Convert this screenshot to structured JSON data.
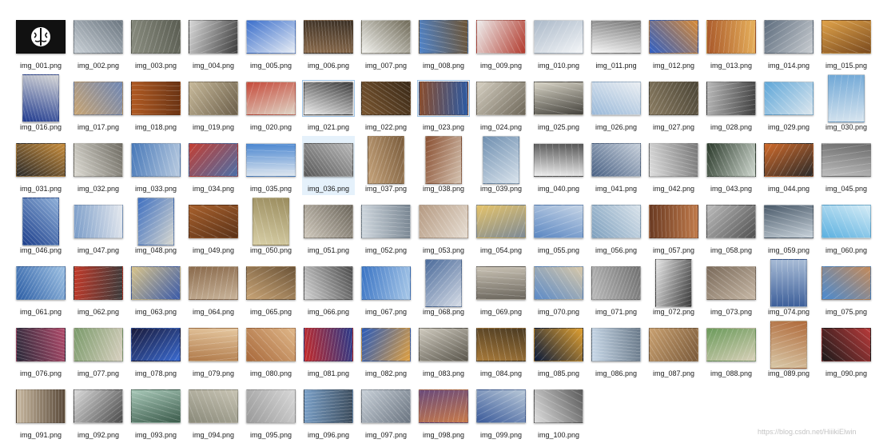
{
  "files": [
    {
      "name": "img_001.png",
      "colors": [
        "#111111",
        "#444444"
      ],
      "icon": "brain-icon"
    },
    {
      "name": "img_002.png",
      "colors": [
        "#c9d0d6",
        "#6b7680"
      ]
    },
    {
      "name": "img_003.png",
      "colors": [
        "#8a8d80",
        "#5a5d52"
      ]
    },
    {
      "name": "img_004.png",
      "colors": [
        "#d8d8d8",
        "#3c3c3c"
      ]
    },
    {
      "name": "img_005.png",
      "colors": [
        "#3a6ecb",
        "#e9eef5"
      ]
    },
    {
      "name": "img_006.png",
      "colors": [
        "#8b6b4c",
        "#3b3025"
      ]
    },
    {
      "name": "img_007.png",
      "colors": [
        "#f2f2ee",
        "#6f6a58"
      ]
    },
    {
      "name": "img_008.png",
      "colors": [
        "#4f83c9",
        "#6d5434"
      ]
    },
    {
      "name": "img_009.png",
      "colors": [
        "#eeeeee",
        "#b23b2e"
      ]
    },
    {
      "name": "img_010.png",
      "colors": [
        "#aab8c8",
        "#f4f6f8"
      ]
    },
    {
      "name": "img_011.png",
      "colors": [
        "#f6f6f6",
        "#777777"
      ]
    },
    {
      "name": "img_012.png",
      "colors": [
        "#2f5fc4",
        "#d88a36"
      ]
    },
    {
      "name": "img_013.png",
      "colors": [
        "#a9582a",
        "#e7b15c"
      ]
    },
    {
      "name": "img_014.png",
      "colors": [
        "#5d6c7d",
        "#c9cdd1"
      ]
    },
    {
      "name": "img_015.png",
      "colors": [
        "#e0a34a",
        "#7a4a1e"
      ]
    },
    {
      "name": "img_016.png",
      "colors": [
        "#1f3a8f",
        "#d6d6d6"
      ]
    },
    {
      "name": "img_017.png",
      "colors": [
        "#c8a472",
        "#6f87b5"
      ]
    },
    {
      "name": "img_018.png",
      "colors": [
        "#b05a22",
        "#6b3414"
      ]
    },
    {
      "name": "img_019.png",
      "colors": [
        "#c7b99a",
        "#6c5f4a"
      ]
    },
    {
      "name": "img_020.png",
      "colors": [
        "#c64a3a",
        "#dfd5c7"
      ]
    },
    {
      "name": "img_021.png",
      "colors": [
        "#ededed",
        "#3a3a3a"
      ]
    },
    {
      "name": "img_022.png",
      "colors": [
        "#7a5630",
        "#3b2a18"
      ]
    },
    {
      "name": "img_023.png",
      "colors": [
        "#8a4d2c",
        "#2c5aa3"
      ]
    },
    {
      "name": "img_024.png",
      "colors": [
        "#d6d0c2",
        "#6d6658"
      ]
    },
    {
      "name": "img_025.png",
      "colors": [
        "#d8d4c6",
        "#44423c"
      ]
    },
    {
      "name": "img_026.png",
      "colors": [
        "#9ab9d9",
        "#eaeef2"
      ]
    },
    {
      "name": "img_027.png",
      "colors": [
        "#8a7c62",
        "#4b4536"
      ]
    },
    {
      "name": "img_028.png",
      "colors": [
        "#b9b9b9",
        "#3f3f3f"
      ]
    },
    {
      "name": "img_029.png",
      "colors": [
        "#5ea6d8",
        "#dde7ee"
      ]
    },
    {
      "name": "img_030.png",
      "colors": [
        "#6fa7d6",
        "#d8e5ef"
      ]
    },
    {
      "name": "img_031.png",
      "colors": [
        "#2b2b2b",
        "#c78c3a"
      ]
    },
    {
      "name": "img_032.png",
      "colors": [
        "#dcdad2",
        "#6f6c63"
      ]
    },
    {
      "name": "img_033.png",
      "colors": [
        "#4778b8",
        "#b9cbe0"
      ]
    },
    {
      "name": "img_034.png",
      "colors": [
        "#c43e32",
        "#4a6fa8"
      ]
    },
    {
      "name": "img_035.png",
      "colors": [
        "#4a86d0",
        "#dfe7ef"
      ]
    },
    {
      "name": "img_036.png",
      "colors": [
        "#585858",
        "#b8b8b8"
      ]
    },
    {
      "name": "img_037.png",
      "colors": [
        "#c4a27a",
        "#7a5c3c"
      ]
    },
    {
      "name": "img_038.png",
      "colors": [
        "#8a5032",
        "#d4c2b0"
      ]
    },
    {
      "name": "img_039.png",
      "colors": [
        "#6f8fb0",
        "#d9e3ec"
      ]
    },
    {
      "name": "img_040.png",
      "colors": [
        "#eeeeee",
        "#555555"
      ]
    },
    {
      "name": "img_041.png",
      "colors": [
        "#4a6285",
        "#c6cfda"
      ]
    },
    {
      "name": "img_042.png",
      "colors": [
        "#dddddd",
        "#777777"
      ]
    },
    {
      "name": "img_043.png",
      "colors": [
        "#2b3a2b",
        "#cfd8cf"
      ]
    },
    {
      "name": "img_044.png",
      "colors": [
        "#d06a2a",
        "#2a2a2a"
      ]
    },
    {
      "name": "img_045.png",
      "colors": [
        "#bdbdbd",
        "#6a6a6a"
      ]
    },
    {
      "name": "img_046.png",
      "colors": [
        "#1d3f8c",
        "#8fb0d8"
      ]
    },
    {
      "name": "img_047.png",
      "colors": [
        "#7a9cc8",
        "#e4e8ee"
      ]
    },
    {
      "name": "img_048.png",
      "colors": [
        "#3e6fc0",
        "#d7d7cf"
      ]
    },
    {
      "name": "img_049.png",
      "colors": [
        "#a7602c",
        "#5b3218"
      ]
    },
    {
      "name": "img_050.png",
      "colors": [
        "#d8cfa7",
        "#9a8c5e"
      ]
    },
    {
      "name": "img_051.png",
      "colors": [
        "#cfc8bc",
        "#6b655a"
      ]
    },
    {
      "name": "img_052.png",
      "colors": [
        "#cfd7de",
        "#7a8793"
      ]
    },
    {
      "name": "img_053.png",
      "colors": [
        "#b59a82",
        "#e6ddd2"
      ]
    },
    {
      "name": "img_054.png",
      "colors": [
        "#e5c36a",
        "#7d8a96"
      ]
    },
    {
      "name": "img_055.png",
      "colors": [
        "#5b87c2",
        "#c5d4e6"
      ]
    },
    {
      "name": "img_056.png",
      "colors": [
        "#7ea0be",
        "#d8e2ea"
      ]
    },
    {
      "name": "img_057.png",
      "colors": [
        "#6a3a22",
        "#c07a4a"
      ]
    },
    {
      "name": "img_058.png",
      "colors": [
        "#bcbcbc",
        "#505050"
      ]
    },
    {
      "name": "img_059.png",
      "colors": [
        "#4a5a6a",
        "#c8d2da"
      ]
    },
    {
      "name": "img_060.png",
      "colors": [
        "#5ab0e0",
        "#d5ecf6"
      ]
    },
    {
      "name": "img_061.png",
      "colors": [
        "#2d5fa6",
        "#9dc0e2"
      ]
    },
    {
      "name": "img_062.png",
      "colors": [
        "#c23a2a",
        "#3a3a3a"
      ]
    },
    {
      "name": "img_063.png",
      "colors": [
        "#d9c48a",
        "#3a5aa8"
      ]
    },
    {
      "name": "img_064.png",
      "colors": [
        "#8a6a4c",
        "#c9b49a"
      ]
    },
    {
      "name": "img_065.png",
      "colors": [
        "#c8a476",
        "#6c5438"
      ]
    },
    {
      "name": "img_066.png",
      "colors": [
        "#d2d2d2",
        "#4c4c4c"
      ]
    },
    {
      "name": "img_067.png",
      "colors": [
        "#3a74c4",
        "#a8c8e8"
      ]
    },
    {
      "name": "img_068.png",
      "colors": [
        "#4a6a9a",
        "#d6dce6"
      ]
    },
    {
      "name": "img_069.png",
      "colors": [
        "#c9c2b4",
        "#6a655c"
      ]
    },
    {
      "name": "img_070.png",
      "colors": [
        "#5a8ac8",
        "#d8c8a8"
      ]
    },
    {
      "name": "img_071.png",
      "colors": [
        "#bababa",
        "#707070"
      ]
    },
    {
      "name": "img_072.png",
      "colors": [
        "#e6e6e6",
        "#3a3a3a"
      ]
    },
    {
      "name": "img_073.png",
      "colors": [
        "#7a6a5a",
        "#c7b8a6"
      ]
    },
    {
      "name": "img_074.png",
      "colors": [
        "#3d5f9a",
        "#a8bcd6"
      ]
    },
    {
      "name": "img_075.png",
      "colors": [
        "#4a8ad0",
        "#c48a5a"
      ]
    },
    {
      "name": "img_076.png",
      "colors": [
        "#2a2a3a",
        "#b04a6a"
      ]
    },
    {
      "name": "img_077.png",
      "colors": [
        "#7a9a6a",
        "#d8d0c0"
      ]
    },
    {
      "name": "img_078.png",
      "colors": [
        "#1a1a3a",
        "#3a6ad0"
      ]
    },
    {
      "name": "img_079.png",
      "colors": [
        "#b07a4a",
        "#e6c8a0"
      ]
    },
    {
      "name": "img_080.png",
      "colors": [
        "#a8683a",
        "#e0b88a"
      ]
    },
    {
      "name": "img_081.png",
      "colors": [
        "#c42a2a",
        "#2a3a8a"
      ]
    },
    {
      "name": "img_082.png",
      "colors": [
        "#2a5ab8",
        "#e0a040"
      ]
    },
    {
      "name": "img_083.png",
      "colors": [
        "#cfcabe",
        "#5a564c"
      ]
    },
    {
      "name": "img_084.png",
      "colors": [
        "#a87a3a",
        "#4a3a22"
      ]
    },
    {
      "name": "img_085.png",
      "colors": [
        "#0a1a3a",
        "#e0a030"
      ]
    },
    {
      "name": "img_086.png",
      "colors": [
        "#c8d8e8",
        "#6a7a8a"
      ]
    },
    {
      "name": "img_087.png",
      "colors": [
        "#c8a070",
        "#7a5a3a"
      ]
    },
    {
      "name": "img_088.png",
      "colors": [
        "#6a9a5a",
        "#d8d0b8"
      ]
    },
    {
      "name": "img_089.png",
      "colors": [
        "#d8c8a8",
        "#b06a3a"
      ]
    },
    {
      "name": "img_090.png",
      "colors": [
        "#1a1a1a",
        "#b83a3a"
      ]
    },
    {
      "name": "img_091.png",
      "colors": [
        "#c8b8a0",
        "#5a4a3a"
      ]
    },
    {
      "name": "img_092.png",
      "colors": [
        "#dadada",
        "#4a4a4a"
      ]
    },
    {
      "name": "img_093.png",
      "colors": [
        "#a8c8b8",
        "#3a5a4a"
      ]
    },
    {
      "name": "img_094.png",
      "colors": [
        "#8a8a7a",
        "#c8c4b4"
      ]
    },
    {
      "name": "img_095.png",
      "colors": [
        "#9a9a9a",
        "#d8d8d8"
      ]
    },
    {
      "name": "img_096.png",
      "colors": [
        "#7aa0c8",
        "#3a4a5a"
      ]
    },
    {
      "name": "img_097.png",
      "colors": [
        "#c8d0d8",
        "#6a7480"
      ]
    },
    {
      "name": "img_098.png",
      "colors": [
        "#6a4a7a",
        "#c87a4a"
      ]
    },
    {
      "name": "img_099.png",
      "colors": [
        "#3a5a9a",
        "#b8c8d8"
      ]
    },
    {
      "name": "img_100.png",
      "colors": [
        "#dedede",
        "#5a5a5a"
      ]
    }
  ],
  "hover_index": 35,
  "framed_indices": [
    20,
    22
  ],
  "watermark": "https://blog.csdn.net/HiiikiElwin"
}
